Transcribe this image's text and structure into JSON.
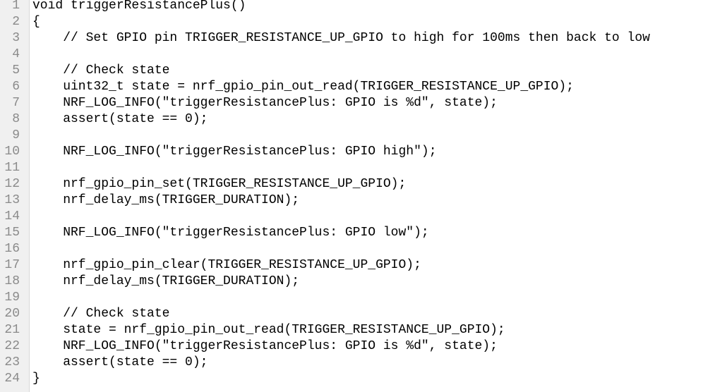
{
  "editor": {
    "lines": [
      {
        "num": "1",
        "text": "void triggerResistancePlus()"
      },
      {
        "num": "2",
        "text": "{"
      },
      {
        "num": "3",
        "text": "    // Set GPIO pin TRIGGER_RESISTANCE_UP_GPIO to high for 100ms then back to low"
      },
      {
        "num": "4",
        "text": ""
      },
      {
        "num": "5",
        "text": "    // Check state"
      },
      {
        "num": "6",
        "text": "    uint32_t state = nrf_gpio_pin_out_read(TRIGGER_RESISTANCE_UP_GPIO);"
      },
      {
        "num": "7",
        "text": "    NRF_LOG_INFO(\"triggerResistancePlus: GPIO is %d\", state);"
      },
      {
        "num": "8",
        "text": "    assert(state == 0);"
      },
      {
        "num": "9",
        "text": ""
      },
      {
        "num": "10",
        "text": "    NRF_LOG_INFO(\"triggerResistancePlus: GPIO high\");"
      },
      {
        "num": "11",
        "text": ""
      },
      {
        "num": "12",
        "text": "    nrf_gpio_pin_set(TRIGGER_RESISTANCE_UP_GPIO);"
      },
      {
        "num": "13",
        "text": "    nrf_delay_ms(TRIGGER_DURATION);"
      },
      {
        "num": "14",
        "text": ""
      },
      {
        "num": "15",
        "text": "    NRF_LOG_INFO(\"triggerResistancePlus: GPIO low\");"
      },
      {
        "num": "16",
        "text": ""
      },
      {
        "num": "17",
        "text": "    nrf_gpio_pin_clear(TRIGGER_RESISTANCE_UP_GPIO);"
      },
      {
        "num": "18",
        "text": "    nrf_delay_ms(TRIGGER_DURATION);"
      },
      {
        "num": "19",
        "text": ""
      },
      {
        "num": "20",
        "text": "    // Check state"
      },
      {
        "num": "21",
        "text": "    state = nrf_gpio_pin_out_read(TRIGGER_RESISTANCE_UP_GPIO);"
      },
      {
        "num": "22",
        "text": "    NRF_LOG_INFO(\"triggerResistancePlus: GPIO is %d\", state);"
      },
      {
        "num": "23",
        "text": "    assert(state == 0);"
      },
      {
        "num": "24",
        "text": "}"
      }
    ]
  },
  "colors": {
    "background": "#ffffff",
    "gutter": "#f0f0f0",
    "line_number": "#8a8a8a",
    "code_text": "#000000"
  }
}
